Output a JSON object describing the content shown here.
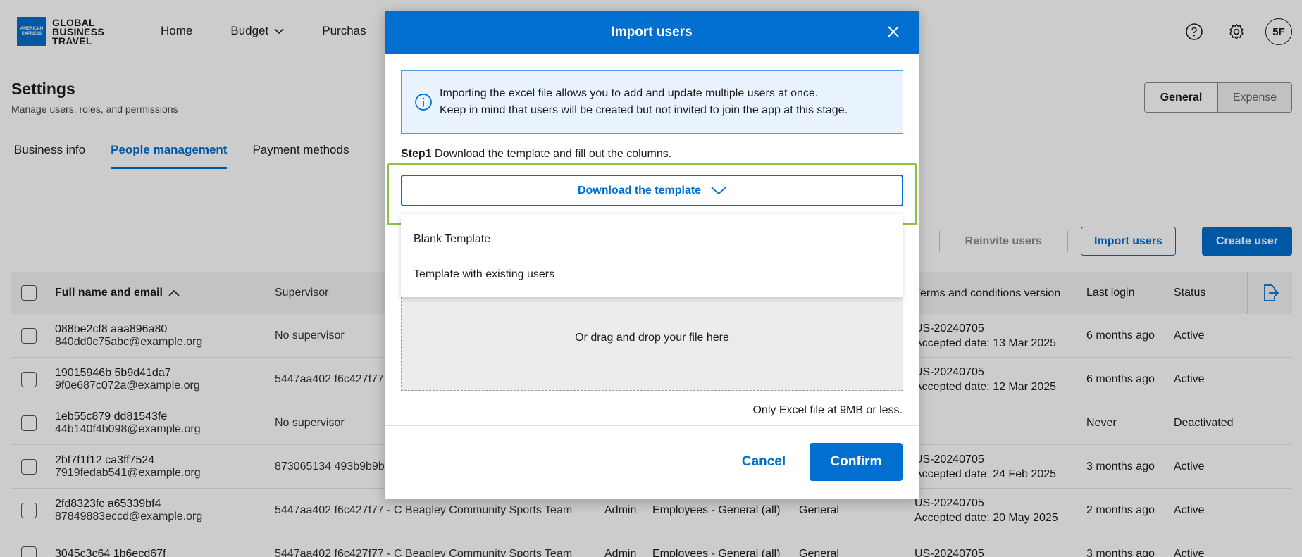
{
  "brand": {
    "logo_mark": "AMERICAN EXPRESS",
    "name_line1": "GLOBAL",
    "name_line2": "BUSINESS",
    "name_line3": "TRAVEL"
  },
  "nav": {
    "home": "Home",
    "budget": "Budget",
    "purchases": "Purchas"
  },
  "top_icons": {
    "help": "help-circle-icon",
    "settings": "gear-icon",
    "avatar": "5F"
  },
  "page": {
    "title": "Settings",
    "subtitle": "Manage users, roles, and permissions"
  },
  "segment": {
    "general": "General",
    "expense": "Expense"
  },
  "tabs": [
    "Business info",
    "People management",
    "Payment methods"
  ],
  "actions": {
    "reinvite": "Reinvite users",
    "import": "Import users",
    "create": "Create user"
  },
  "table": {
    "headers": {
      "name": "Full name and email",
      "supervisor": "Supervisor",
      "terms": "Terms and conditions version",
      "last_login": "Last login",
      "status": "Status"
    },
    "rows": [
      {
        "name": "088be2cf8 aaa896a80",
        "email": "840dd0c75abc@example.org",
        "supervisor": "No supervisor",
        "role": "",
        "group": "",
        "policy": "",
        "terms": "US-20240705",
        "accepted": "Accepted date: 13 Mar 2025",
        "last_login": "6 months ago",
        "status": "Active"
      },
      {
        "name": "19015946b 5b9d41da7",
        "email": "9f0e687c072a@example.org",
        "supervisor": "5447aa402 f6c427f77",
        "role": "",
        "group": "",
        "policy": "",
        "terms": "US-20240705",
        "accepted": "Accepted date: 12 Mar 2025",
        "last_login": "6 months ago",
        "status": "Active"
      },
      {
        "name": "1eb55c879 dd81543fe",
        "email": "44b140f4b098@example.org",
        "supervisor": "No supervisor",
        "role": "",
        "group": "",
        "policy": "",
        "terms": "",
        "accepted": "",
        "last_login": "Never",
        "status": "Deactivated"
      },
      {
        "name": "2bf7f1f12 ca3ff7524",
        "email": "7919fedab541@example.org",
        "supervisor": "873065134 493b9b9b",
        "role": "",
        "group": "",
        "policy": "",
        "terms": "US-20240705",
        "accepted": "Accepted date: 24 Feb 2025",
        "last_login": "3 months ago",
        "status": "Active"
      },
      {
        "name": "2fd8323fc a65339bf4",
        "email": "87849883eccd@example.org",
        "supervisor": "5447aa402 f6c427f77 - C Beagley Community Sports Team",
        "role": "Admin",
        "group": "Employees - General (all)",
        "policy": "General",
        "terms": "US-20240705",
        "accepted": "Accepted date: 20 May 2025",
        "last_login": "2 months ago",
        "status": "Active"
      },
      {
        "name": "3045c3c64 1b6ecd67f",
        "email": "",
        "supervisor": "5447aa402 f6c427f77 - C Beagley Community Sports Team",
        "role": "Admin",
        "group": "Employees - General (all)",
        "policy": "General",
        "terms": "US-20240705",
        "accepted": "",
        "last_login": "3 months ago",
        "status": "Active"
      }
    ]
  },
  "modal": {
    "title": "Import users",
    "info_line1": "Importing the excel file allows you to add and update multiple users at once.",
    "info_line2": "Keep in mind that users will be created but not invited to join the app at this stage.",
    "step1_label": "Step1",
    "step1_text": "Download the template and fill out the columns.",
    "download_label": "Download the template",
    "menu_items": [
      "Blank Template",
      "Template with existing users"
    ],
    "drag_text": "Or drag and drop your file here",
    "file_note": "Only Excel file at 9MB or less.",
    "cancel": "Cancel",
    "confirm": "Confirm"
  },
  "colors": {
    "accent": "#006fcf",
    "highlight": "#8cc43c",
    "info_bg": "#e8f3fd"
  }
}
